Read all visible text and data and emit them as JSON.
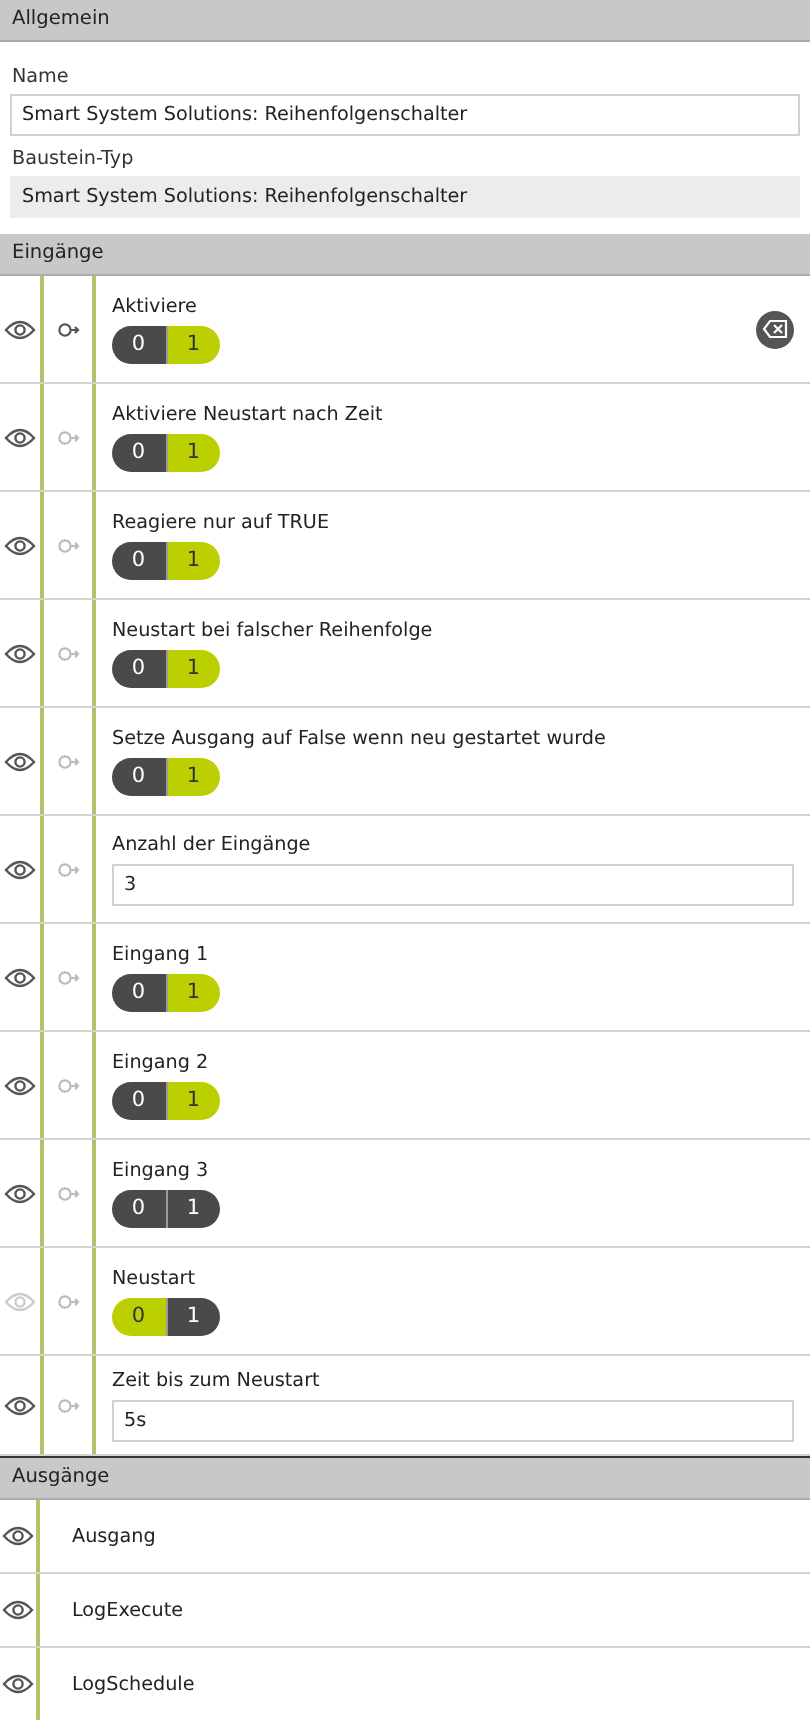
{
  "general": {
    "title": "Allgemein",
    "fields": [
      {
        "label": "Name",
        "value": "Smart System Solutions: Reihenfolgenschalter",
        "readonly": false
      },
      {
        "label": "Baustein-Typ",
        "value": "Smart System Solutions: Reihenfolgenschalter",
        "readonly": true
      }
    ]
  },
  "inputs": {
    "title": "Eingänge",
    "rows": [
      {
        "kind": "toggle",
        "label": "Aktiviere",
        "visible": true,
        "linked": true,
        "clearable": true,
        "options": [
          {
            "label": "0",
            "selected": false
          },
          {
            "label": "1",
            "selected": true
          }
        ]
      },
      {
        "kind": "toggle",
        "label": "Aktiviere Neustart nach Zeit",
        "visible": true,
        "linked": false,
        "clearable": false,
        "options": [
          {
            "label": "0",
            "selected": false
          },
          {
            "label": "1",
            "selected": true
          }
        ]
      },
      {
        "kind": "toggle",
        "label": "Reagiere nur auf TRUE",
        "visible": true,
        "linked": false,
        "clearable": false,
        "options": [
          {
            "label": "0",
            "selected": false
          },
          {
            "label": "1",
            "selected": true
          }
        ]
      },
      {
        "kind": "toggle",
        "label": "Neustart bei falscher Reihenfolge",
        "visible": true,
        "linked": false,
        "clearable": false,
        "options": [
          {
            "label": "0",
            "selected": false
          },
          {
            "label": "1",
            "selected": true
          }
        ]
      },
      {
        "kind": "toggle",
        "label": "Setze Ausgang auf False wenn neu gestartet wurde",
        "visible": true,
        "linked": false,
        "clearable": false,
        "options": [
          {
            "label": "0",
            "selected": false
          },
          {
            "label": "1",
            "selected": true
          }
        ]
      },
      {
        "kind": "field",
        "label": "Anzahl der Eingänge",
        "visible": true,
        "linked": false,
        "clearable": false,
        "value": "3"
      },
      {
        "kind": "toggle",
        "label": "Eingang 1",
        "visible": true,
        "linked": false,
        "clearable": false,
        "options": [
          {
            "label": "0",
            "selected": false
          },
          {
            "label": "1",
            "selected": true
          }
        ]
      },
      {
        "kind": "toggle",
        "label": "Eingang 2",
        "visible": true,
        "linked": false,
        "clearable": false,
        "options": [
          {
            "label": "0",
            "selected": false
          },
          {
            "label": "1",
            "selected": true
          }
        ]
      },
      {
        "kind": "toggle",
        "label": "Eingang 3",
        "visible": true,
        "linked": false,
        "clearable": false,
        "options": [
          {
            "label": "0",
            "selected": false
          },
          {
            "label": "1",
            "selected": false
          }
        ]
      },
      {
        "kind": "toggle",
        "label": "Neustart",
        "visible": false,
        "linked": false,
        "clearable": false,
        "options": [
          {
            "label": "0",
            "selected": true
          },
          {
            "label": "1",
            "selected": false
          }
        ]
      },
      {
        "kind": "field",
        "label": "Zeit bis zum Neustart",
        "visible": true,
        "linked": false,
        "clearable": false,
        "value": "5s"
      }
    ]
  },
  "outputs": {
    "title": "Ausgänge",
    "rows": [
      {
        "label": "Ausgang"
      },
      {
        "label": "LogExecute"
      },
      {
        "label": "LogSchedule"
      }
    ]
  }
}
